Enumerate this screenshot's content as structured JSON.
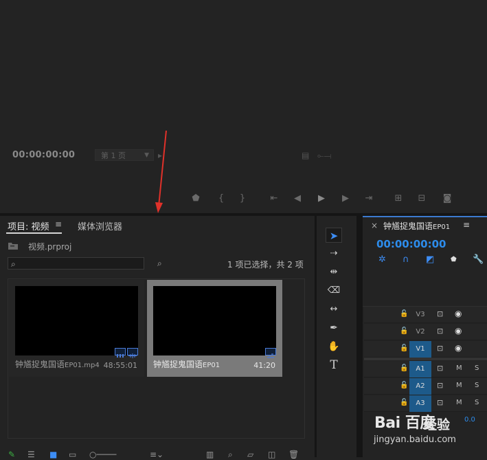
{
  "source_monitor": {
    "timecode": "00:00:00:00",
    "page_select": "第 1 页",
    "controls": [
      "marker",
      "in",
      "out",
      "go-in",
      "step-back",
      "play",
      "step-forward",
      "go-out",
      "insert",
      "overwrite",
      "export-frame"
    ]
  },
  "project_panel": {
    "tab_project": "项目: 视频",
    "tab_media_browser": "媒体浏览器",
    "project_file": "视频.prproj",
    "search_placeholder": "",
    "selection_status": "1 项已选择，共 2 项",
    "items": [
      {
        "name_main": "钟馗捉鬼国语",
        "name_small": "EP01.mp4",
        "duration": "48:55:01",
        "selected": false
      },
      {
        "name_main": "钟馗捉鬼国语",
        "name_small": "EP01",
        "duration": "41:20",
        "selected": true
      }
    ]
  },
  "timeline": {
    "sequence_name_main": "钟馗捉鬼国语",
    "sequence_name_small": "EP01",
    "timecode": "00:00:00:00",
    "video_tracks": [
      "V3",
      "V2",
      "V1"
    ],
    "audio_tracks": [
      "A1",
      "A2",
      "A3"
    ],
    "mute_label": "M",
    "solo_label": "S",
    "volume_value": "0.0"
  },
  "watermark": {
    "logo": "Bai 百度",
    "sub": "经验",
    "url": "jingyan.baidu.com"
  },
  "colors": {
    "accent": "#2d8ceb",
    "selected_track": "#1d5a8a",
    "arrow": "#e0312a"
  }
}
